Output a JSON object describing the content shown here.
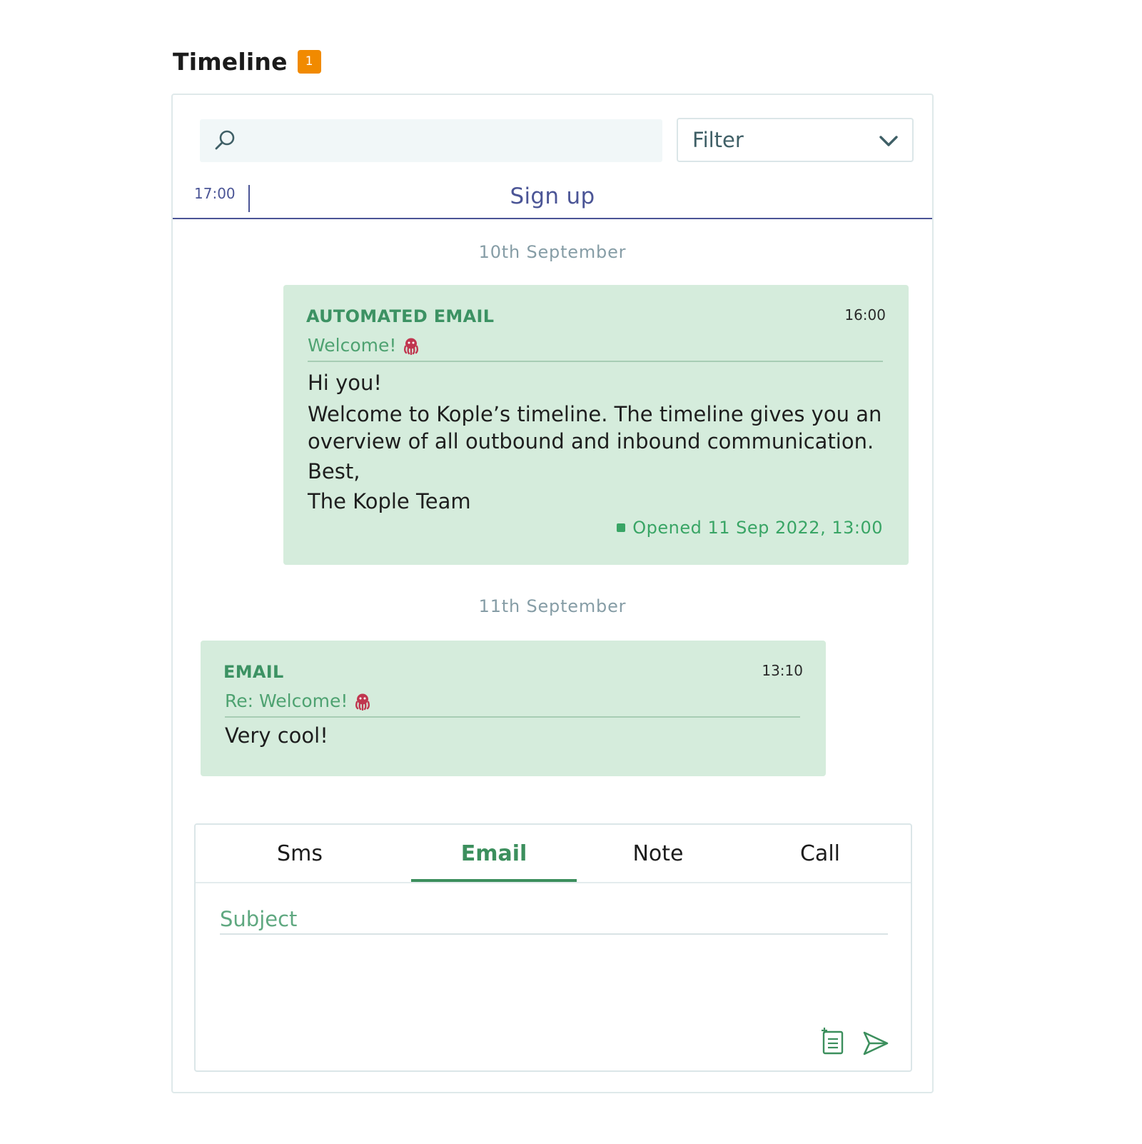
{
  "header": {
    "title": "Timeline",
    "badge_count": "1"
  },
  "search": {
    "placeholder": ""
  },
  "filter": {
    "label": "Filter"
  },
  "signup": {
    "time": "17:00",
    "label": "Sign up"
  },
  "days": [
    {
      "label": "10th September"
    },
    {
      "label": "11th September"
    }
  ],
  "messages": [
    {
      "kind": "AUTOMATED EMAIL",
      "time": "16:00",
      "subject": "Welcome!",
      "body": [
        "Hi you!",
        "Welcome to Kople’s timeline. The timeline gives you an",
        "overview of all outbound and inbound communication.",
        "Best,",
        "The Kople Team"
      ],
      "status": "Opened 11 Sep 2022, 13:00"
    },
    {
      "kind": "EMAIL",
      "time": "13:10",
      "subject": "Re: Welcome!",
      "body": [
        "Very cool!"
      ]
    }
  ],
  "composer": {
    "tabs": [
      {
        "label": "Sms"
      },
      {
        "label": "Email"
      },
      {
        "label": "Note"
      },
      {
        "label": "Call"
      }
    ],
    "active_tab": "Email",
    "subject_placeholder": "Subject"
  },
  "colors": {
    "accent_green": "#3c8f5d",
    "card_bg": "#d5ecdc",
    "badge": "#f18a00",
    "signup": "#4b5596"
  },
  "icons": {
    "search": "search-icon",
    "filter": "chevron-down-icon",
    "emoji": "octopus-icon",
    "template": "template-icon",
    "send": "send-icon"
  }
}
